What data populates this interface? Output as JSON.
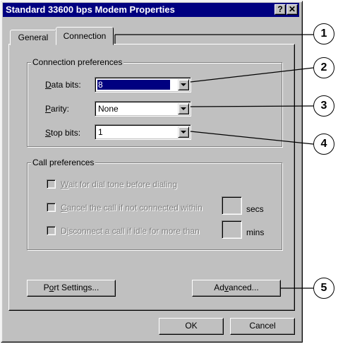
{
  "window": {
    "title": "Standard 33600 bps Modem Properties",
    "help_btn": "?",
    "close_btn": "✕"
  },
  "tabs": [
    {
      "label": "General",
      "active": false
    },
    {
      "label": "Connection",
      "active": true
    }
  ],
  "connection_prefs": {
    "legend": "Connection preferences",
    "data_bits": {
      "label_u": "D",
      "label_rest": "ata bits:",
      "value": "8"
    },
    "parity": {
      "label_u": "P",
      "label_rest": "arity:",
      "value": "None"
    },
    "stop_bits": {
      "label_u": "S",
      "label_rest": "top bits:",
      "value": "1"
    }
  },
  "call_prefs": {
    "legend": "Call preferences",
    "wait": {
      "u": "W",
      "rest": "ait for dial tone before dialing"
    },
    "cancel": {
      "u": "C",
      "rest": "ancel the call if not connected within",
      "unit": "secs"
    },
    "disconnect": {
      "pre": "D",
      "u": "i",
      "rest": "sconnect a call if idle for more than",
      "unit": "mins"
    }
  },
  "buttons": {
    "port": {
      "pre": "P",
      "u": "o",
      "rest": "rt Settings..."
    },
    "advanced": {
      "pre": "Ad",
      "u": "v",
      "rest": "anced..."
    },
    "ok": "OK",
    "cancel": "Cancel"
  },
  "callouts": [
    "1",
    "2",
    "3",
    "4",
    "5"
  ]
}
